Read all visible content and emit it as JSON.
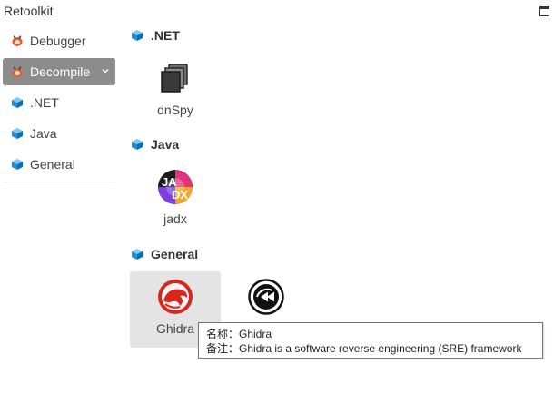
{
  "window": {
    "title": "Retoolkit"
  },
  "sidebar": {
    "items": [
      {
        "label": "Debugger",
        "icon": "bug-icon",
        "active": false
      },
      {
        "label": "Decompile",
        "icon": "bug-icon",
        "active": true
      },
      {
        "label": ".NET",
        "icon": "cube-icon",
        "active": false
      },
      {
        "label": "Java",
        "icon": "cube-icon",
        "active": false
      },
      {
        "label": "General",
        "icon": "cube-icon",
        "active": false
      }
    ]
  },
  "main": {
    "sections": [
      {
        "title": ".NET",
        "tools": [
          {
            "name": "dnSpy",
            "icon": "dnspy-icon"
          }
        ]
      },
      {
        "title": "Java",
        "tools": [
          {
            "name": "jadx",
            "icon": "jadx-icon"
          }
        ]
      },
      {
        "title": "General",
        "tools": [
          {
            "name": "Ghidra",
            "icon": "ghidra-icon"
          },
          {
            "name": "",
            "icon": "rewind-circle-icon"
          }
        ]
      }
    ]
  },
  "tooltip": {
    "line1": "名称：Ghidra",
    "line2": "备注：Ghidra is a software reverse engineering (SRE) framework"
  },
  "colors": {
    "active_nav_bg": "#8c8c8c",
    "hover_tile_bg": "#e4e4e4",
    "cube_blue": "#1f8fd6",
    "bug_orange": "#f05a28",
    "ghidra_red": "#d9261c"
  }
}
